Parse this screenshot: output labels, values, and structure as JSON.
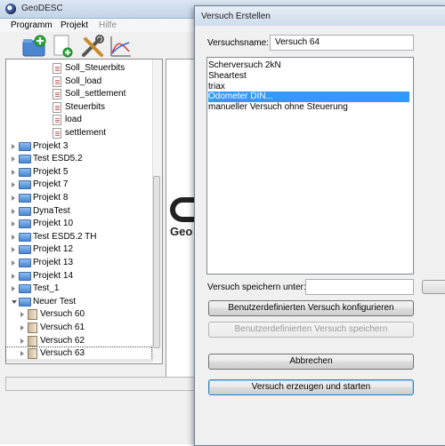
{
  "window": {
    "title": "GeoDESC"
  },
  "menu": [
    {
      "label": "Programm",
      "disabled": false
    },
    {
      "label": "Projekt",
      "disabled": false
    },
    {
      "label": "Hilfe",
      "disabled": true
    }
  ],
  "toolbar": {
    "buttons": [
      {
        "icon": "new-folder-icon"
      },
      {
        "icon": "new-document-icon"
      },
      {
        "icon": "tools-icon"
      },
      {
        "icon": "chart-icon"
      }
    ]
  },
  "tree": {
    "items": [
      {
        "label": "Soll_Steuerbits",
        "kind": "doc",
        "level": 3,
        "expander": "none"
      },
      {
        "label": "Soll_load",
        "kind": "doc",
        "level": 3,
        "expander": "none"
      },
      {
        "label": "Soll_settlement",
        "kind": "doc",
        "level": 3,
        "expander": "none"
      },
      {
        "label": "Steuerbits",
        "kind": "doc",
        "level": 3,
        "expander": "none"
      },
      {
        "label": "load",
        "kind": "doc",
        "level": 3,
        "expander": "none"
      },
      {
        "label": "settlement",
        "kind": "doc",
        "level": 3,
        "expander": "none"
      },
      {
        "label": "Projekt 3",
        "kind": "folder",
        "level": 1,
        "expander": "closed"
      },
      {
        "label": "Test ESD5.2",
        "kind": "folder",
        "level": 1,
        "expander": "closed"
      },
      {
        "label": "Projekt 5",
        "kind": "folder",
        "level": 1,
        "expander": "closed"
      },
      {
        "label": "Projekt 7",
        "kind": "folder",
        "level": 1,
        "expander": "closed"
      },
      {
        "label": "Projekt 8",
        "kind": "folder",
        "level": 1,
        "expander": "closed"
      },
      {
        "label": "DynaTest",
        "kind": "folder",
        "level": 1,
        "expander": "closed"
      },
      {
        "label": "Projekt 10",
        "kind": "folder",
        "level": 1,
        "expander": "closed"
      },
      {
        "label": "Test ESD5.2 TH",
        "kind": "folder",
        "level": 1,
        "expander": "closed"
      },
      {
        "label": "Projekt 12",
        "kind": "folder",
        "level": 1,
        "expander": "closed"
      },
      {
        "label": "Projekt 13",
        "kind": "folder",
        "level": 1,
        "expander": "closed"
      },
      {
        "label": "Projekt 14",
        "kind": "folder",
        "level": 1,
        "expander": "closed"
      },
      {
        "label": "Test_1",
        "kind": "folder",
        "level": 1,
        "expander": "closed"
      },
      {
        "label": "Neuer Test",
        "kind": "folder",
        "level": 1,
        "expander": "open"
      },
      {
        "label": "Versuch 60",
        "kind": "vol",
        "level": 2,
        "expander": "closed"
      },
      {
        "label": "Versuch 61",
        "kind": "vol",
        "level": 2,
        "expander": "closed"
      },
      {
        "label": "Versuch 62",
        "kind": "vol",
        "level": 2,
        "expander": "closed"
      },
      {
        "label": "Versuch 63",
        "kind": "vol",
        "level": 2,
        "expander": "closed",
        "selected": true
      }
    ]
  },
  "brand": {
    "text": "Geo"
  },
  "dialog": {
    "title": "Versuch Erstellen",
    "name_label": "Versuchsname:",
    "name_value": "Versuch 64",
    "list": [
      {
        "label": "Scherversuch 2kN",
        "selected": false
      },
      {
        "label": "Sheartest",
        "selected": false
      },
      {
        "label": "triax",
        "selected": false
      },
      {
        "label": "Odometer DIN...",
        "selected": true
      },
      {
        "label": "manueller Versuch ohne Steuerung",
        "selected": false
      }
    ],
    "save_label": "Versuch speichern unter:",
    "save_value": "",
    "configure_button": "Benutzerdefinierten Versuch  konfigurieren",
    "save_custom_button": "Benutzerdefinierten Versuch speichern",
    "cancel_button": "Abbrechen",
    "create_button": "Versuch erzeugen und starten"
  },
  "colors": {
    "selection": "#3399ff",
    "titlebar": "#cfdcec"
  }
}
